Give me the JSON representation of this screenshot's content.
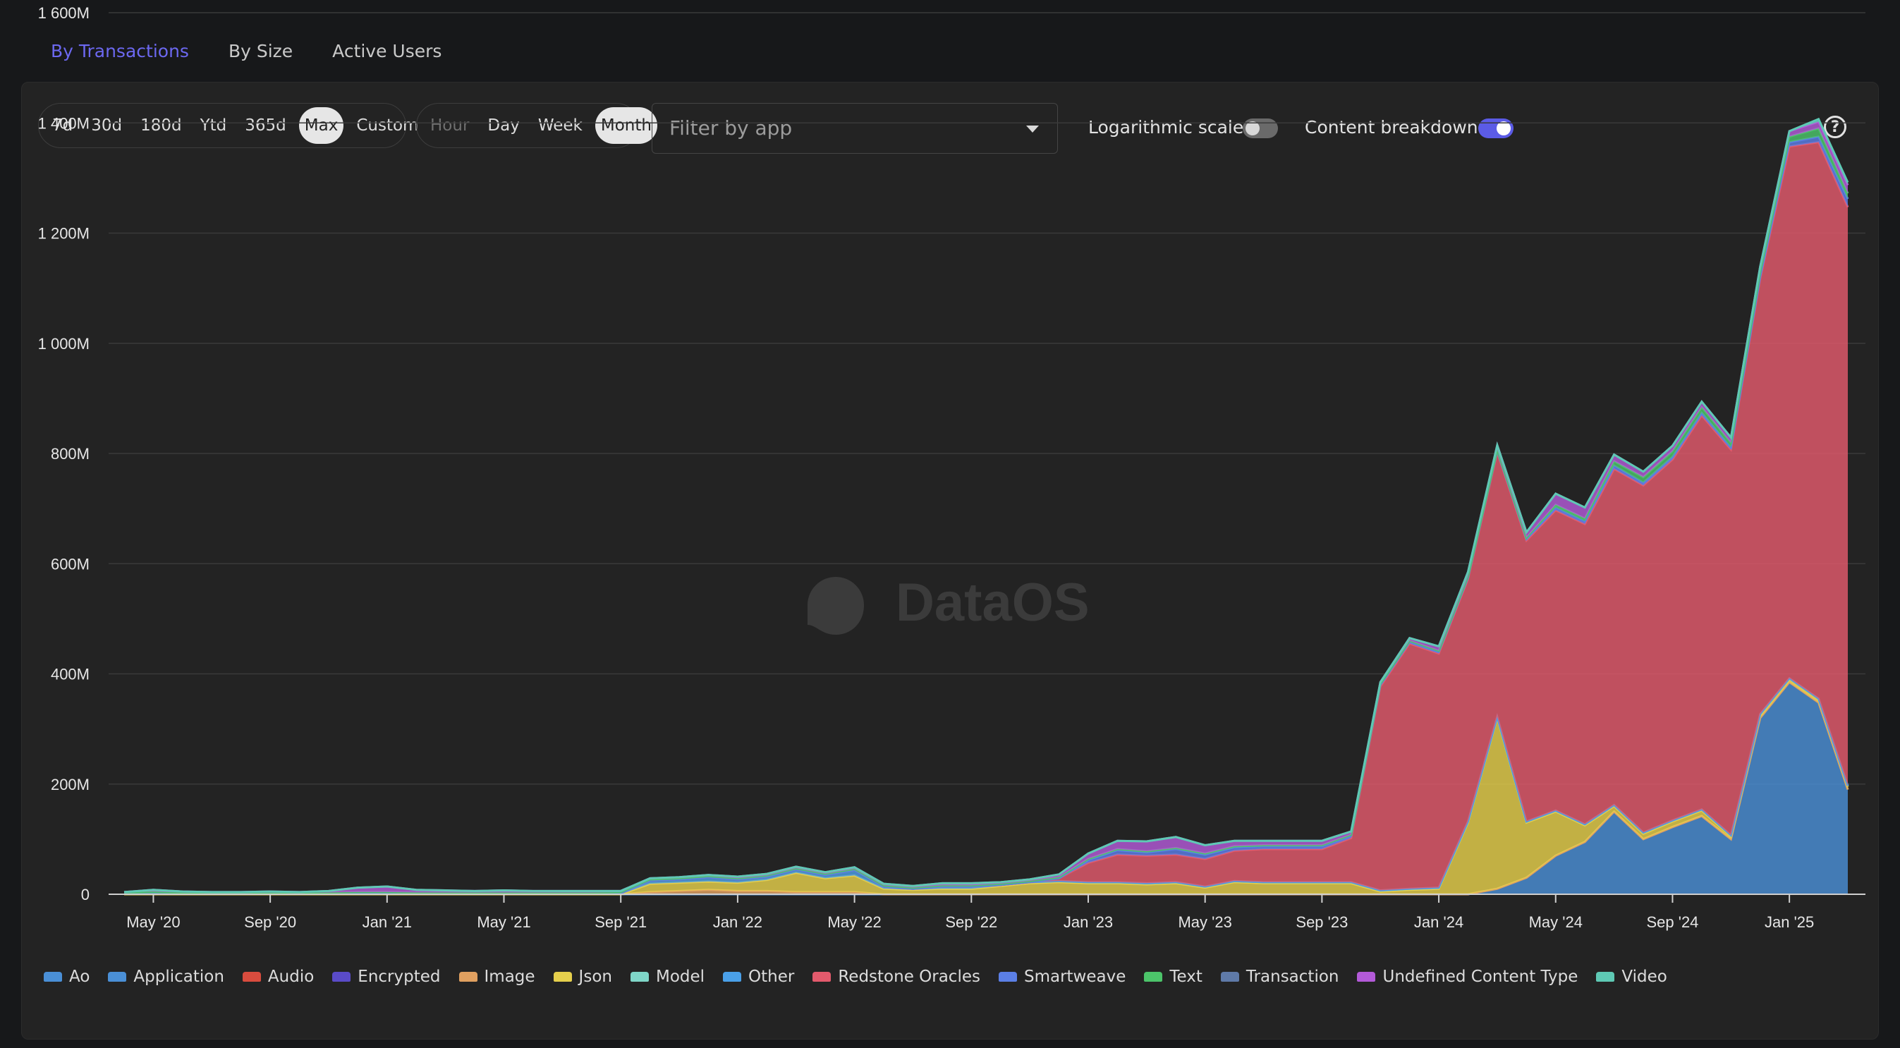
{
  "tabs": [
    "By Transactions",
    "By Size",
    "Active Users"
  ],
  "ranges": [
    "7d",
    "30d",
    "180d",
    "Ytd",
    "365d",
    "Max",
    "Custom"
  ],
  "range_selected": "Max",
  "intervals": [
    "Hour",
    "Day",
    "Week",
    "Month"
  ],
  "interval_selected": "Month",
  "interval_disabled": "Hour",
  "filter": {
    "placeholder": "Filter by app"
  },
  "toggles": {
    "log_label": "Logarithmic scale",
    "log_on": false,
    "breakdown_label": "Content breakdown",
    "breakdown_on": true
  },
  "help_glyph": "?",
  "watermark": "DataOS",
  "colors": {
    "accent": "#6c68f0",
    "panel": "#232323",
    "toggle_on": "#5b5be6"
  },
  "chart_data": {
    "type": "area",
    "stacked": true,
    "title": "",
    "xlabel": "",
    "ylabel": "",
    "ylim": [
      0,
      1600
    ],
    "y_unit": "M",
    "y_ticks": [
      "0",
      "200M",
      "400M",
      "600M",
      "800M",
      "1 000M",
      "1 200M",
      "1 400M",
      "1 600M"
    ],
    "x_ticks": [
      "May '20",
      "Sep '20",
      "Jan '21",
      "May '21",
      "Sep '21",
      "Jan '22",
      "May '22",
      "Sep '22",
      "Jan '23",
      "May '23",
      "Sep '23",
      "Jan '24",
      "May '24",
      "Sep '24",
      "Jan '25"
    ],
    "x": [
      "2020-04",
      "2020-05",
      "2020-06",
      "2020-07",
      "2020-08",
      "2020-09",
      "2020-10",
      "2020-11",
      "2020-12",
      "2021-01",
      "2021-02",
      "2021-03",
      "2021-04",
      "2021-05",
      "2021-06",
      "2021-07",
      "2021-08",
      "2021-09",
      "2021-10",
      "2021-11",
      "2021-12",
      "2022-01",
      "2022-02",
      "2022-03",
      "2022-04",
      "2022-05",
      "2022-06",
      "2022-07",
      "2022-08",
      "2022-09",
      "2022-10",
      "2022-11",
      "2022-12",
      "2023-01",
      "2023-02",
      "2023-03",
      "2023-04",
      "2023-05",
      "2023-06",
      "2023-07",
      "2023-08",
      "2023-09",
      "2023-10",
      "2023-11",
      "2023-12",
      "2024-01",
      "2024-02",
      "2024-03",
      "2024-04",
      "2024-05",
      "2024-06",
      "2024-07",
      "2024-08",
      "2024-09",
      "2024-10",
      "2024-11",
      "2024-12",
      "2025-01",
      "2025-02",
      "2025-03"
    ],
    "series": [
      {
        "name": "Ao",
        "color": "#4a8fd6",
        "values": [
          0,
          0,
          0,
          0,
          0,
          0,
          0,
          0,
          0,
          0,
          0,
          0,
          0,
          0,
          0,
          0,
          0,
          0,
          0,
          0,
          0,
          0,
          0,
          0,
          0,
          0,
          0,
          0,
          0,
          0,
          0,
          0,
          0,
          0,
          0,
          0,
          0,
          0,
          0,
          0,
          0,
          0,
          0,
          0,
          0,
          0,
          0,
          10,
          30,
          70,
          95,
          150,
          100,
          122,
          142,
          100,
          320,
          385,
          348,
          190
        ]
      },
      {
        "name": "Application",
        "color": "#4a8fd6",
        "values": [
          0,
          0,
          0,
          0,
          0,
          0,
          0,
          0,
          0,
          0,
          0,
          0,
          0,
          0,
          0,
          0,
          0,
          0,
          0,
          0,
          0,
          0,
          0,
          0,
          0,
          0,
          0,
          0,
          0,
          0,
          0,
          0,
          0,
          0,
          0,
          0,
          0,
          0,
          0,
          0,
          0,
          0,
          0,
          0,
          0,
          0,
          0,
          0,
          0,
          0,
          0,
          0,
          0,
          0,
          0,
          0,
          0,
          0,
          0,
          0
        ]
      },
      {
        "name": "Audio",
        "color": "#d94c3e",
        "values": [
          0,
          0,
          0,
          0,
          0,
          0,
          0,
          0,
          0,
          0,
          0,
          0,
          0,
          0,
          0,
          0,
          0,
          0,
          0,
          0,
          0,
          0,
          0,
          0,
          0,
          0,
          0,
          0,
          0,
          0,
          0,
          0,
          0,
          0,
          0,
          0,
          0,
          0,
          0,
          0,
          0,
          0,
          0,
          0,
          0,
          0,
          0,
          0,
          0,
          0,
          0,
          0,
          0,
          0,
          0,
          0,
          0,
          0,
          0,
          0
        ]
      },
      {
        "name": "Encrypted",
        "color": "#5a4bc8",
        "values": [
          0,
          0,
          0,
          0,
          0,
          0,
          0,
          0,
          0,
          0,
          0,
          0,
          0,
          0,
          0,
          0,
          0,
          0,
          0,
          0,
          0,
          0,
          0,
          0,
          0,
          0,
          0,
          0,
          0,
          0,
          0,
          0,
          0,
          0,
          0,
          0,
          0,
          0,
          0,
          0,
          0,
          0,
          0,
          0,
          0,
          0,
          0,
          0,
          0,
          0,
          0,
          0,
          0,
          0,
          0,
          0,
          0,
          0,
          0,
          0
        ]
      },
      {
        "name": "Image",
        "color": "#e0a060",
        "values": [
          0,
          0,
          0,
          0,
          0,
          0,
          0,
          0,
          0,
          0,
          0,
          0,
          0,
          0,
          0,
          0,
          0,
          0,
          4,
          6,
          8,
          6,
          6,
          4,
          4,
          4,
          0,
          0,
          0,
          0,
          0,
          0,
          0,
          0,
          0,
          0,
          0,
          0,
          0,
          0,
          0,
          0,
          0,
          0,
          0,
          0,
          0,
          0,
          0,
          0,
          0,
          0,
          0,
          0,
          0,
          0,
          0,
          0,
          0,
          0
        ]
      },
      {
        "name": "Json",
        "color": "#e5cf4c",
        "values": [
          0,
          0,
          0,
          0,
          0,
          0,
          0,
          0,
          0,
          0,
          0,
          0,
          0,
          0,
          0,
          0,
          0,
          0,
          15,
          15,
          15,
          15,
          20,
          35,
          25,
          30,
          10,
          8,
          10,
          10,
          15,
          20,
          22,
          20,
          20,
          18,
          20,
          12,
          22,
          20,
          20,
          20,
          20,
          5,
          8,
          10,
          130,
          310,
          100,
          80,
          30,
          10,
          10,
          10,
          10,
          5,
          5,
          5,
          5,
          5
        ]
      },
      {
        "name": "Model",
        "color": "#7fd6c8",
        "values": [
          0,
          0,
          0,
          0,
          0,
          0,
          0,
          0,
          0,
          0,
          0,
          0,
          0,
          0,
          0,
          0,
          0,
          0,
          0,
          0,
          0,
          0,
          0,
          0,
          0,
          0,
          0,
          0,
          0,
          0,
          0,
          0,
          0,
          0,
          0,
          0,
          0,
          0,
          0,
          0,
          0,
          0,
          0,
          0,
          0,
          0,
          0,
          0,
          0,
          0,
          0,
          0,
          0,
          0,
          0,
          0,
          0,
          0,
          0,
          0
        ]
      },
      {
        "name": "Other",
        "color": "#4aa0e8",
        "values": [
          1,
          2,
          1,
          1,
          1,
          1,
          1,
          1,
          2,
          2,
          1,
          1,
          1,
          1,
          1,
          1,
          1,
          2,
          6,
          6,
          8,
          6,
          6,
          6,
          6,
          10,
          4,
          2,
          4,
          4,
          2,
          2,
          2,
          2,
          2,
          2,
          2,
          2,
          2,
          2,
          2,
          2,
          2,
          2,
          2,
          2,
          2,
          2,
          2,
          2,
          2,
          2,
          2,
          2,
          2,
          2,
          2,
          2,
          2,
          2
        ]
      },
      {
        "name": "Redstone Oracles",
        "color": "#e35a6c",
        "values": [
          0,
          0,
          0,
          0,
          0,
          0,
          0,
          0,
          0,
          0,
          0,
          0,
          0,
          0,
          0,
          0,
          0,
          0,
          0,
          0,
          0,
          0,
          0,
          0,
          0,
          0,
          0,
          0,
          0,
          0,
          0,
          0,
          5,
          35,
          50,
          50,
          50,
          50,
          55,
          60,
          60,
          60,
          80,
          370,
          445,
          425,
          440,
          480,
          510,
          545,
          545,
          610,
          630,
          655,
          715,
          700,
          790,
          965,
          1010,
          1050
        ]
      },
      {
        "name": "Smartweave",
        "color": "#5b7fe6",
        "values": [
          0,
          0,
          0,
          0,
          0,
          0,
          0,
          0,
          0,
          0,
          0,
          0,
          0,
          0,
          0,
          0,
          0,
          0,
          0,
          0,
          0,
          0,
          0,
          0,
          0,
          0,
          0,
          0,
          0,
          0,
          0,
          0,
          0,
          5,
          8,
          6,
          10,
          8,
          6,
          5,
          5,
          5,
          4,
          3,
          3,
          3,
          3,
          3,
          3,
          5,
          5,
          6,
          5,
          5,
          5,
          4,
          4,
          8,
          10,
          15
        ]
      },
      {
        "name": "Text",
        "color": "#4cc46a",
        "values": [
          3,
          3,
          2,
          2,
          2,
          2,
          2,
          2,
          2,
          2,
          2,
          2,
          2,
          2,
          2,
          2,
          2,
          2,
          2,
          2,
          2,
          2,
          2,
          2,
          2,
          2,
          2,
          2,
          2,
          2,
          2,
          2,
          2,
          2,
          2,
          2,
          2,
          2,
          2,
          2,
          2,
          2,
          2,
          2,
          2,
          2,
          2,
          2,
          2,
          5,
          5,
          8,
          10,
          10,
          10,
          8,
          8,
          10,
          15,
          10
        ]
      },
      {
        "name": "Transaction",
        "color": "#5f7aa8",
        "values": [
          0,
          0,
          0,
          0,
          0,
          0,
          0,
          0,
          0,
          0,
          0,
          0,
          0,
          0,
          0,
          0,
          0,
          0,
          0,
          0,
          0,
          0,
          0,
          0,
          0,
          0,
          0,
          0,
          0,
          0,
          0,
          0,
          0,
          0,
          0,
          0,
          0,
          0,
          0,
          0,
          0,
          0,
          0,
          0,
          0,
          0,
          0,
          0,
          0,
          0,
          0,
          0,
          0,
          0,
          0,
          0,
          0,
          0,
          0,
          0
        ]
      },
      {
        "name": "Undefined Content Type",
        "color": "#b35ad8",
        "values": [
          0,
          3,
          2,
          1,
          1,
          2,
          1,
          3,
          8,
          10,
          5,
          4,
          3,
          4,
          3,
          3,
          3,
          2,
          2,
          2,
          2,
          3,
          3,
          3,
          3,
          3,
          3,
          3,
          4,
          4,
          3,
          3,
          5,
          10,
          15,
          18,
          20,
          15,
          10,
          8,
          8,
          8,
          6,
          3,
          5,
          8,
          8,
          8,
          10,
          20,
          20,
          12,
          10,
          10,
          10,
          10,
          10,
          10,
          12,
          15
        ]
      },
      {
        "name": "Video",
        "color": "#5ec9b4",
        "values": [
          0,
          0,
          0,
          0,
          0,
          0,
          0,
          0,
          0,
          0,
          0,
          0,
          0,
          0,
          0,
          0,
          0,
          0,
          0,
          0,
          0,
          0,
          0,
          0,
          0,
          0,
          0,
          0,
          0,
          0,
          0,
          0,
          0,
          0,
          0,
          0,
          0,
          0,
          0,
          0,
          0,
          0,
          0,
          0,
          0,
          0,
          0,
          0,
          0,
          0,
          0,
          0,
          0,
          0,
          0,
          0,
          0,
          0,
          5,
          5
        ]
      }
    ],
    "grid": true,
    "legend_position": "bottom-left"
  }
}
